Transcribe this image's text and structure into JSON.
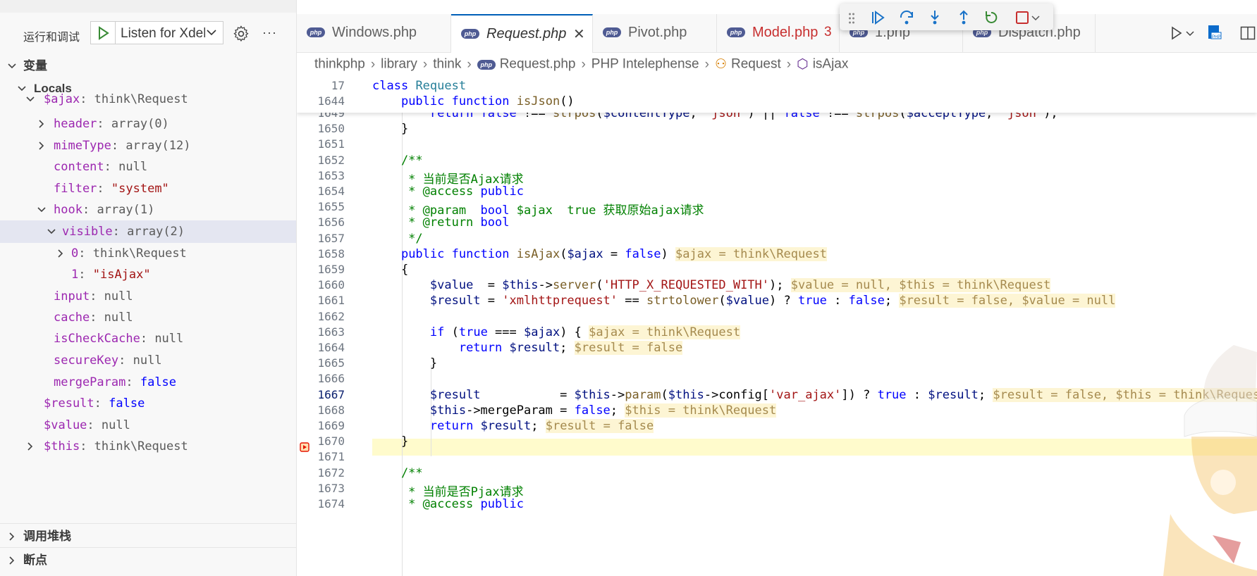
{
  "sidebar": {
    "run_title": "运行和调试",
    "config_name": "Listen for Xdebug",
    "sections": {
      "variables": "变量",
      "locals": "Locals",
      "call_stack": "调用堆栈",
      "breakpoints": "断点"
    },
    "variables": [
      {
        "name": "$ajax",
        "sep": ": ",
        "value": "think\\Request",
        "kind": "obj"
      },
      {
        "name": "header",
        "sep": ": ",
        "value": "array(0)",
        "kind": "obj"
      },
      {
        "name": "mimeType",
        "sep": ": ",
        "value": "array(12)",
        "kind": "obj"
      },
      {
        "name": "content",
        "sep": ": ",
        "value": "null",
        "kind": "obj"
      },
      {
        "name": "filter",
        "sep": ": ",
        "value": "\"system\"",
        "kind": "str"
      },
      {
        "name": "hook",
        "sep": ": ",
        "value": "array(1)",
        "kind": "obj"
      },
      {
        "name": "visible",
        "sep": ": ",
        "value": "array(2)",
        "kind": "obj"
      },
      {
        "name": "0",
        "sep": ": ",
        "value": "think\\Request",
        "kind": "obj"
      },
      {
        "name": "1",
        "sep": ": ",
        "value": "\"isAjax\"",
        "kind": "str"
      },
      {
        "name": "input",
        "sep": ": ",
        "value": "null",
        "kind": "obj"
      },
      {
        "name": "cache",
        "sep": ": ",
        "value": "null",
        "kind": "obj"
      },
      {
        "name": "isCheckCache",
        "sep": ": ",
        "value": "null",
        "kind": "obj"
      },
      {
        "name": "secureKey",
        "sep": ": ",
        "value": "null",
        "kind": "obj"
      },
      {
        "name": "mergeParam",
        "sep": ": ",
        "value": "false",
        "kind": "bool"
      },
      {
        "name": "$result",
        "sep": ": ",
        "value": "false",
        "kind": "bool"
      },
      {
        "name": "$value",
        "sep": ": ",
        "value": "null",
        "kind": "obj"
      },
      {
        "name": "$this",
        "sep": ": ",
        "value": "think\\Request",
        "kind": "obj"
      }
    ]
  },
  "tabs": [
    {
      "label": "Windows.php"
    },
    {
      "label": "Request.php"
    },
    {
      "label": "Pivot.php"
    },
    {
      "label": "Model.php",
      "badge": "3"
    },
    {
      "label": "1.php"
    },
    {
      "label": "Dispatch.php"
    }
  ],
  "breadcrumb": [
    "thinkphp",
    "library",
    "think",
    "Request.php",
    "PHP Intelephense",
    "Request",
    "isAjax"
  ],
  "sticky": [
    {
      "line": "17",
      "text": "class Request"
    },
    {
      "line": "1644",
      "text": "    public function isJson()"
    }
  ],
  "lines": [
    {
      "n": "1649",
      "code": "        return false !== strpos($contentType, 'json') || false !== strpos($acceptType, 'json');"
    },
    {
      "n": "1650",
      "code": "    }"
    },
    {
      "n": "1651",
      "code": ""
    },
    {
      "n": "1652",
      "code": "    /**"
    },
    {
      "n": "1653",
      "code": "     * 当前是否Ajax请求"
    },
    {
      "n": "1654",
      "code": "     * @access public"
    },
    {
      "n": "1655",
      "code": "     * @param  bool $ajax  true 获取原始ajax请求"
    },
    {
      "n": "1656",
      "code": "     * @return bool"
    },
    {
      "n": "1657",
      "code": "     */"
    },
    {
      "n": "1658",
      "code": "    public function isAjax($ajax = false)",
      "inline": "$ajax = think\\Request"
    },
    {
      "n": "1659",
      "code": "    {"
    },
    {
      "n": "1660",
      "code": "        $value  = $this->server('HTTP_X_REQUESTED_WITH');",
      "inline": "$value = null, $this = think\\Request"
    },
    {
      "n": "1661",
      "code": "        $result = 'xmlhttprequest' == strtolower($value) ? true : false;",
      "inline": "$result = false, $value = null"
    },
    {
      "n": "1662",
      "code": ""
    },
    {
      "n": "1663",
      "code": "        if (true === $ajax) {",
      "inline": "$ajax = think\\Request"
    },
    {
      "n": "1664",
      "code": "            return $result;",
      "inline": "$result = false"
    },
    {
      "n": "1665",
      "code": "        }"
    },
    {
      "n": "1666",
      "code": ""
    },
    {
      "n": "1667",
      "code": "        $result           = $this->param($this->config['var_ajax']) ? true : $result;",
      "inline": "$result = false, $this = think\\Request"
    },
    {
      "n": "1668",
      "code": "        $this->mergeParam = false;",
      "inline": "$this = think\\Request"
    },
    {
      "n": "1669",
      "code": "        return $result;",
      "inline": "$result = false"
    },
    {
      "n": "1670",
      "code": "    }"
    },
    {
      "n": "1671",
      "code": ""
    },
    {
      "n": "1672",
      "code": "    /**"
    },
    {
      "n": "1673",
      "code": "     * 当前是否Pjax请求"
    },
    {
      "n": "1674",
      "code": "     * @access public"
    }
  ],
  "current_line": "1667",
  "colors": {
    "accent": "#005fb8",
    "current_line": "#fffbcc",
    "inline_bg": "#fdf5d4",
    "breakpoint": "#e51400"
  }
}
